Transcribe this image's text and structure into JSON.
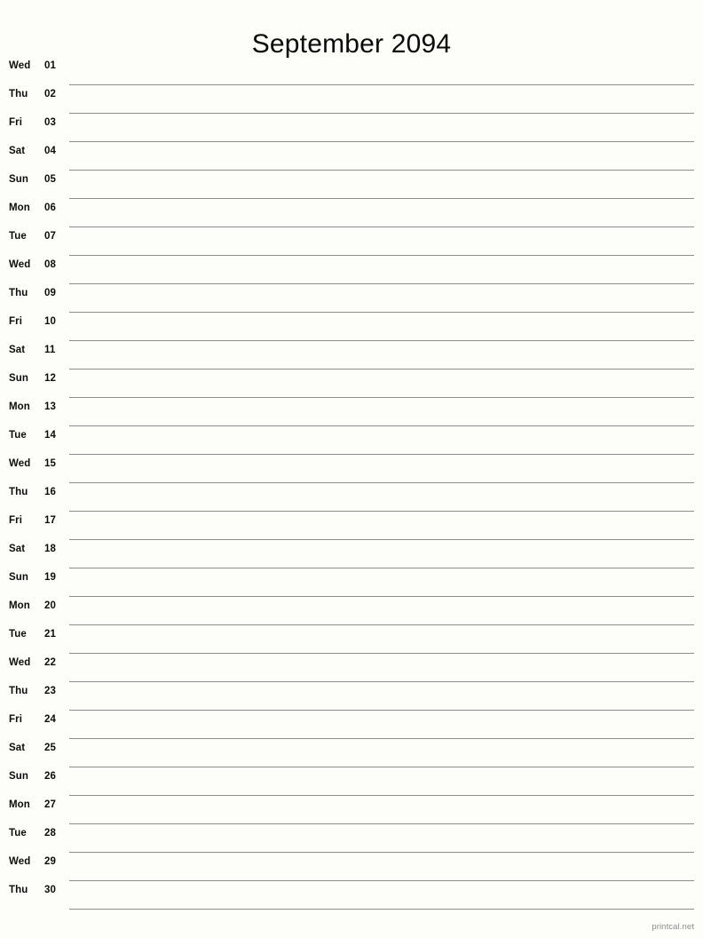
{
  "document": {
    "title": "September 2094",
    "month": "September",
    "year": "2094",
    "layout": "single-column-notes",
    "paper": "letter-portrait"
  },
  "colors": {
    "background": "#fdfdfa",
    "text": "#0d0d0d",
    "rule": "#8a8f88",
    "footer_text": "#8d8d8d"
  },
  "footer": {
    "brand": "printcal.net"
  },
  "days": [
    {
      "weekday": "Wed",
      "date": "01"
    },
    {
      "weekday": "Thu",
      "date": "02"
    },
    {
      "weekday": "Fri",
      "date": "03"
    },
    {
      "weekday": "Sat",
      "date": "04"
    },
    {
      "weekday": "Sun",
      "date": "05"
    },
    {
      "weekday": "Mon",
      "date": "06"
    },
    {
      "weekday": "Tue",
      "date": "07"
    },
    {
      "weekday": "Wed",
      "date": "08"
    },
    {
      "weekday": "Thu",
      "date": "09"
    },
    {
      "weekday": "Fri",
      "date": "10"
    },
    {
      "weekday": "Sat",
      "date": "11"
    },
    {
      "weekday": "Sun",
      "date": "12"
    },
    {
      "weekday": "Mon",
      "date": "13"
    },
    {
      "weekday": "Tue",
      "date": "14"
    },
    {
      "weekday": "Wed",
      "date": "15"
    },
    {
      "weekday": "Thu",
      "date": "16"
    },
    {
      "weekday": "Fri",
      "date": "17"
    },
    {
      "weekday": "Sat",
      "date": "18"
    },
    {
      "weekday": "Sun",
      "date": "19"
    },
    {
      "weekday": "Mon",
      "date": "20"
    },
    {
      "weekday": "Tue",
      "date": "21"
    },
    {
      "weekday": "Wed",
      "date": "22"
    },
    {
      "weekday": "Thu",
      "date": "23"
    },
    {
      "weekday": "Fri",
      "date": "24"
    },
    {
      "weekday": "Sat",
      "date": "25"
    },
    {
      "weekday": "Sun",
      "date": "26"
    },
    {
      "weekday": "Mon",
      "date": "27"
    },
    {
      "weekday": "Tue",
      "date": "28"
    },
    {
      "weekday": "Wed",
      "date": "29"
    },
    {
      "weekday": "Thu",
      "date": "30"
    }
  ]
}
